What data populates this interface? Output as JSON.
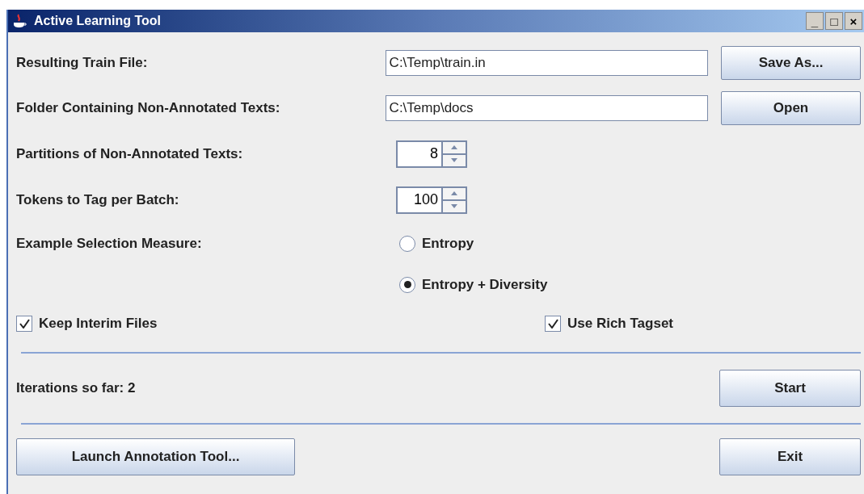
{
  "window": {
    "title": "Active Learning Tool",
    "controls": [
      "_",
      "□",
      "×"
    ]
  },
  "file_rows": [
    {
      "label": "Resulting Train File:",
      "value": "C:\\Temp\\train.in",
      "button": "Save As..."
    },
    {
      "label": "Folder Containing Non-Annotated Texts:",
      "value": "C:\\Temp\\docs",
      "button": "Open"
    }
  ],
  "spinners": [
    {
      "label": "Partitions of Non-Annotated Texts:",
      "value": "8"
    },
    {
      "label": "Tokens to Tag per Batch:",
      "value": "100"
    }
  ],
  "selection": {
    "label": "Example Selection Measure:",
    "options": [
      {
        "label": "Entropy",
        "selected": false
      },
      {
        "label": "Entropy + Diversity",
        "selected": true
      }
    ]
  },
  "checkboxes": [
    {
      "label": "Keep Interim Files",
      "checked": true
    },
    {
      "label": "Use Rich Tagset",
      "checked": true
    }
  ],
  "status": "Iterations so far: 2",
  "start_button": "Start",
  "bottom_buttons": [
    "Launch Annotation Tool...",
    "Exit"
  ]
}
